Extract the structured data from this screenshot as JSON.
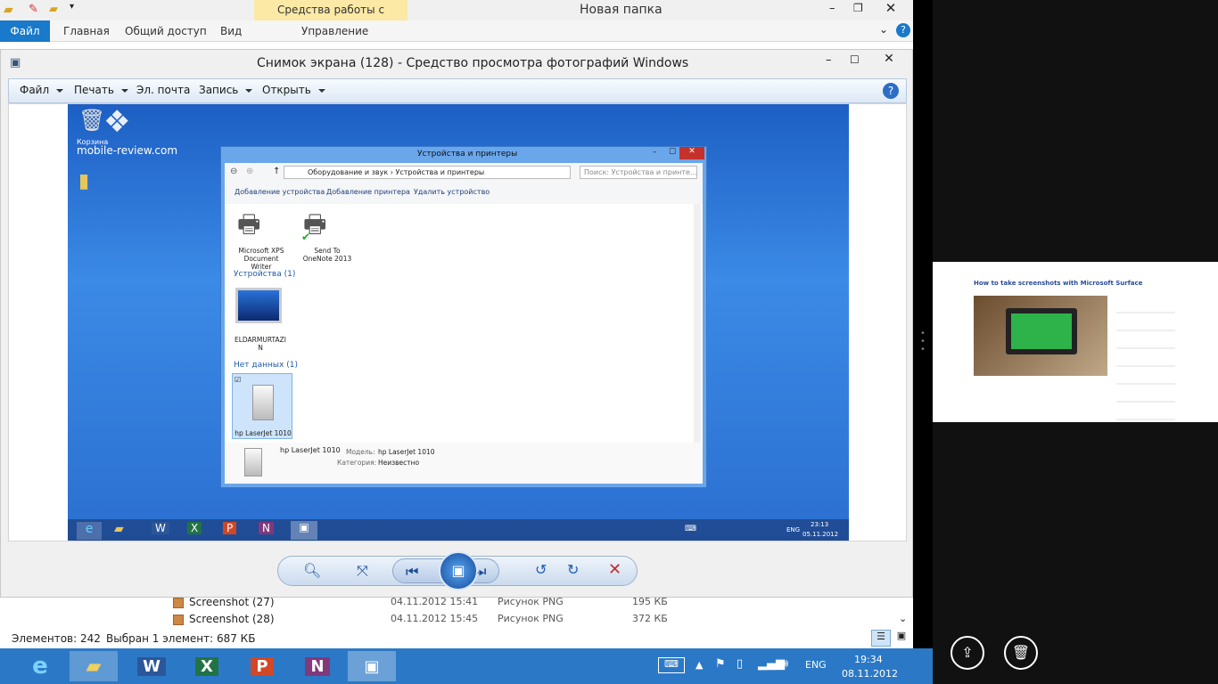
{
  "explorer": {
    "title": "Новая папка",
    "ribbon_context": "Средства работы с рисунками",
    "tabs": [
      "Файл",
      "Главная",
      "Общий доступ",
      "Вид",
      "Управление"
    ],
    "rows": [
      {
        "name": "Screenshot (27)",
        "date": "04.11.2012 15:41",
        "type": "Рисунок PNG",
        "size": "195 КБ"
      },
      {
        "name": "Screenshot (28)",
        "date": "04.11.2012 15:45",
        "type": "Рисунок PNG",
        "size": "372 КБ"
      }
    ],
    "status_count": "Элементов: 242",
    "status_selected": "Выбран 1 элемент: 687 КБ"
  },
  "viewer": {
    "title": "Снимок экрана (128) - Средство просмотра фотографий Windows",
    "menu": [
      "Файл",
      "Печать",
      "Эл. почта",
      "Запись",
      "Открыть"
    ]
  },
  "inner": {
    "watermark": "mobile-review.com",
    "recycle": "Корзина",
    "devwin_title": "Устройства и принтеры",
    "address": [
      "Оборудование и звук",
      "Устройства и принтеры"
    ],
    "search_placeholder": "Поиск: Устройства и принте...",
    "toolbar": [
      "Добавление устройства",
      "Добавление принтера",
      "Удалить устройство"
    ],
    "printer1": "Microsoft XPS Document Writer",
    "printer2": "Send To OneNote 2013",
    "group_devices": "Устройства (1)",
    "device": "ELDARMURTAZIN",
    "group_nodata": "Нет данных (1)",
    "nodata_device": "hp LaserJet 1010",
    "details_name": "hp LaserJet 1010",
    "details_model_label": "Модель:",
    "details_model": "hp LaserJet 1010",
    "details_cat_label": "Категория:",
    "details_cat": "Неизвестно",
    "tray_lang": "ENG",
    "tray_time": "23:13",
    "tray_date": "05.11.2012"
  },
  "snap": {
    "heading": "How to take screenshots with Microsoft Surface"
  },
  "taskbar": {
    "lang": "ENG",
    "time": "19:34",
    "date": "08.11.2012"
  }
}
